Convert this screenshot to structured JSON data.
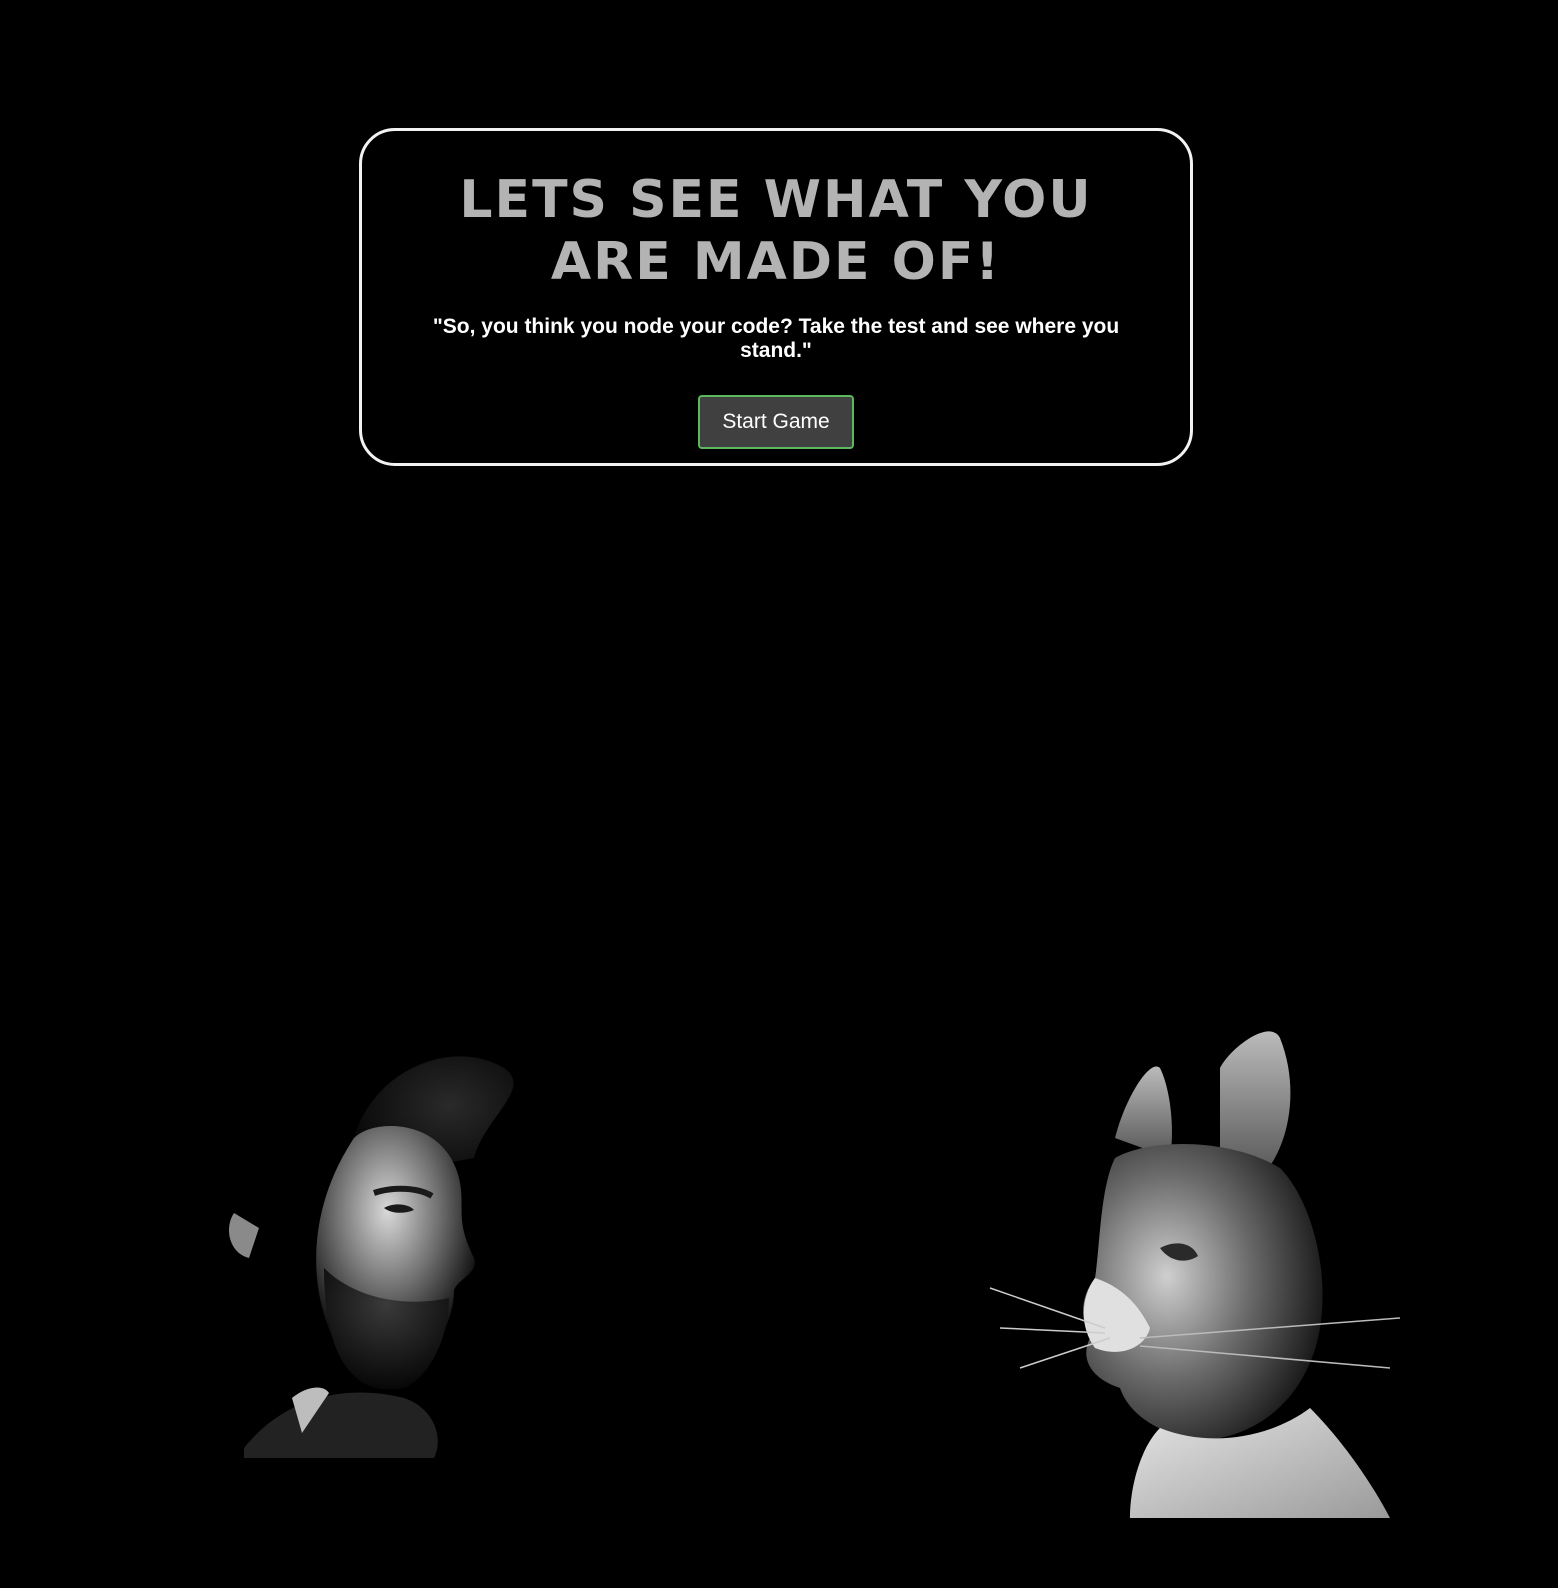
{
  "intro": {
    "title": "Lets see what you are made of!",
    "tagline": "\"So, you think you node your code? Take the test and see where you stand.\"",
    "start_button_label": "Start Game"
  },
  "images": {
    "left": "man-profile-portrait",
    "right": "cat-profile-portrait"
  },
  "colors": {
    "background": "#000000",
    "card_border": "#f2f2f2",
    "title_text": "#b3b3b3",
    "button_bg": "#404040",
    "button_border": "#5cb85c"
  }
}
